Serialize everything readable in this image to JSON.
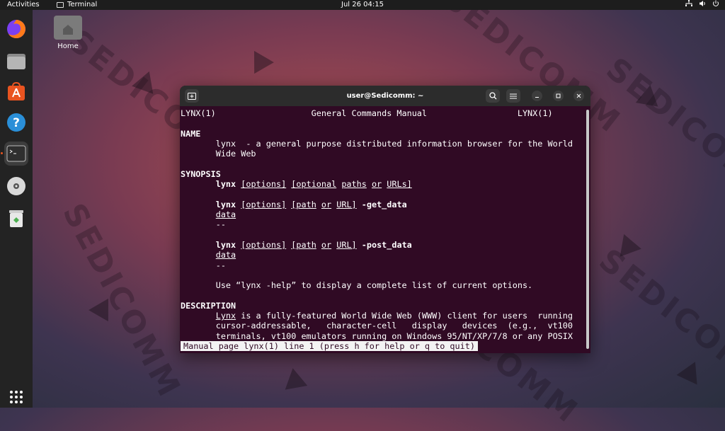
{
  "topbar": {
    "activities": "Activities",
    "app_name": "Terminal",
    "clock": "Jul 26  04:15",
    "icons": [
      "network-icon",
      "volume-icon",
      "power-icon"
    ]
  },
  "dock": {
    "items": [
      "firefox",
      "files",
      "software",
      "help",
      "terminal",
      "cd-drive",
      "trash",
      "app-grid"
    ]
  },
  "desktop": {
    "home_label": "Home"
  },
  "watermark": "SEDICOMM",
  "terminal": {
    "title": "user@Sedicomm: ~",
    "lines": [
      [
        {
          "t": "LYNX(1)                   General Commands Manual                  LYNX(1)"
        }
      ],
      [
        {
          "t": ""
        }
      ],
      [
        {
          "t": "NAME",
          "c": "b"
        }
      ],
      [
        {
          "t": "       lynx  - a general purpose distributed information browser for the World"
        }
      ],
      [
        {
          "t": "       Wide Web"
        }
      ],
      [
        {
          "t": ""
        }
      ],
      [
        {
          "t": "SYNOPSIS",
          "c": "b"
        }
      ],
      [
        {
          "t": "       "
        },
        {
          "t": "lynx",
          "c": "b"
        },
        {
          "t": " "
        },
        {
          "t": "[options]",
          "c": "u"
        },
        {
          "t": " "
        },
        {
          "t": "[optional",
          "c": "u"
        },
        {
          "t": " "
        },
        {
          "t": "paths",
          "c": "u"
        },
        {
          "t": " "
        },
        {
          "t": "or",
          "c": "u"
        },
        {
          "t": " "
        },
        {
          "t": "URLs]",
          "c": "u"
        }
      ],
      [
        {
          "t": ""
        }
      ],
      [
        {
          "t": "       "
        },
        {
          "t": "lynx",
          "c": "b"
        },
        {
          "t": " "
        },
        {
          "t": "[options]",
          "c": "u"
        },
        {
          "t": " "
        },
        {
          "t": "[path",
          "c": "u"
        },
        {
          "t": " "
        },
        {
          "t": "or",
          "c": "u"
        },
        {
          "t": " "
        },
        {
          "t": "URL]",
          "c": "u"
        },
        {
          "t": " "
        },
        {
          "t": "-get_data",
          "c": "b"
        }
      ],
      [
        {
          "t": "       "
        },
        {
          "t": "data",
          "c": "u"
        }
      ],
      [
        {
          "t": "       --"
        }
      ],
      [
        {
          "t": ""
        }
      ],
      [
        {
          "t": "       "
        },
        {
          "t": "lynx",
          "c": "b"
        },
        {
          "t": " "
        },
        {
          "t": "[options]",
          "c": "u"
        },
        {
          "t": " "
        },
        {
          "t": "[path",
          "c": "u"
        },
        {
          "t": " "
        },
        {
          "t": "or",
          "c": "u"
        },
        {
          "t": " "
        },
        {
          "t": "URL]",
          "c": "u"
        },
        {
          "t": " "
        },
        {
          "t": "-post_data",
          "c": "b"
        }
      ],
      [
        {
          "t": "       "
        },
        {
          "t": "data",
          "c": "u"
        }
      ],
      [
        {
          "t": "       --"
        }
      ],
      [
        {
          "t": ""
        }
      ],
      [
        {
          "t": "       Use “lynx -help” to display a complete list of current options."
        }
      ],
      [
        {
          "t": ""
        }
      ],
      [
        {
          "t": "DESCRIPTION",
          "c": "b"
        }
      ],
      [
        {
          "t": "       "
        },
        {
          "t": "Lynx",
          "c": "u"
        },
        {
          "t": " is a fully-featured World Wide Web (WWW) client for users  running"
        }
      ],
      [
        {
          "t": "       cursor-addressable,   character-cell   display   devices  (e.g.,  vt100"
        }
      ],
      [
        {
          "t": "       terminals, vt100 emulators running on Windows 95/NT/XP/7/8 or any POSIX"
        }
      ]
    ],
    "status": "Manual page lynx(1) line 1 (press h for help or q to quit)"
  }
}
